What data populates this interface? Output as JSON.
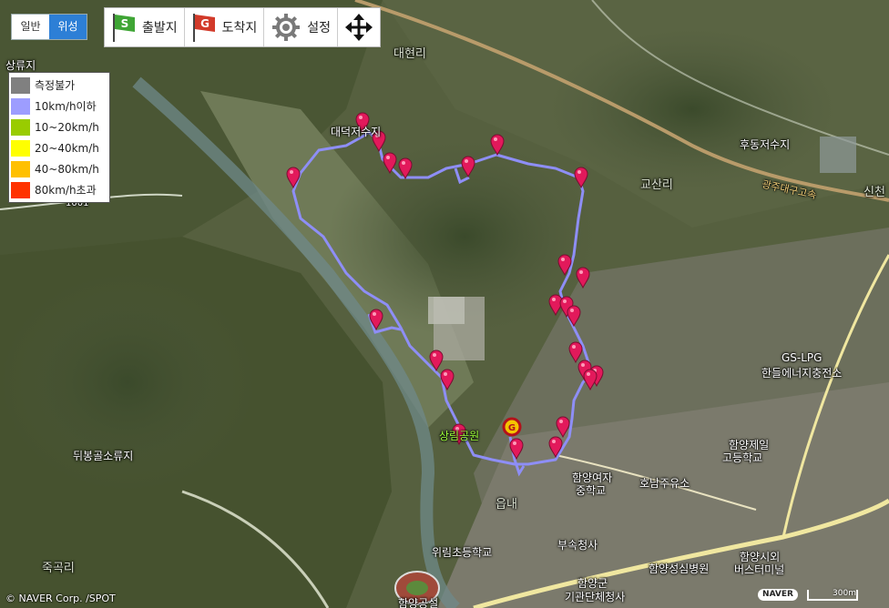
{
  "map_type_toggle": {
    "normal": "일반",
    "satellite": "위성",
    "selected": "satellite"
  },
  "toolbar": {
    "start_label": "출발지",
    "start_icon": "start-flag-icon",
    "end_label": "도착지",
    "end_icon": "goal-flag-icon",
    "settings_label": "설정",
    "settings_icon": "gear-icon",
    "move_icon": "move-arrows-icon"
  },
  "legend": [
    {
      "label": "측정불가",
      "color": "#808080"
    },
    {
      "label": "10km/h이하",
      "color": "#9d9dff"
    },
    {
      "label": "10~20km/h",
      "color": "#99cc00"
    },
    {
      "label": "20~40km/h",
      "color": "#ffff00"
    },
    {
      "label": "40~80km/h",
      "color": "#ffc000"
    },
    {
      "label": "80km/h초과",
      "color": "#ff3300"
    }
  ],
  "route": {
    "color": "#8e8ef6",
    "speed_class": "10km/h이하"
  },
  "map_labels": {
    "daeseok": "대덕저수지",
    "daehyeon": "대현리",
    "hudong": "후동저수지",
    "gyosan": "교산리",
    "gwangju": "광주대구고속",
    "gs_lpg": "GS-LPG",
    "hanteul": "한들에너지충전소",
    "jeil": "함양제일",
    "jeil2": "고등학교",
    "yeojung": "함양여자",
    "yeojung2": "중학교",
    "honam": "호남주유소",
    "busu": "부속청사",
    "gun": "함양군",
    "gun2": "기관단체청사",
    "hospital": "함양성심병원",
    "terminal": "함양시외",
    "terminal2": "버스터미널",
    "wirim": "위림초등학교",
    "sanglim": "상림공원",
    "dwibong": "뒤봉골소류지",
    "jukgok": "죽곡리",
    "eup": "읍내",
    "stadium": "함양공설",
    "sanggyo": "상류지",
    "yongpyeong": "1001",
    "sincheon": "신천"
  },
  "copyright": "© NAVER Corp. /SPOT",
  "scale": {
    "label": "300m"
  },
  "naver_logo": "NAVER"
}
